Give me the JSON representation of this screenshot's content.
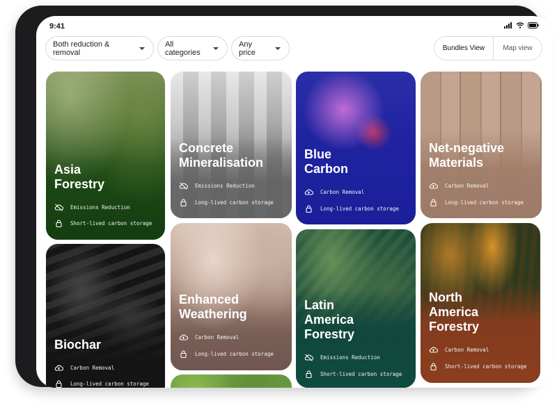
{
  "status": {
    "time": "9:41"
  },
  "filters": [
    {
      "label": "Both reduction & removal"
    },
    {
      "label": "All categories"
    },
    {
      "label": "Any price"
    }
  ],
  "views": {
    "bundles": "Bundles View",
    "map": "Map view"
  },
  "tags": {
    "emissions": "Emissions Reduction",
    "removal": "Carbon Removal",
    "short": "Short-lived carbon storage",
    "long": "Long-lived carbon storage"
  },
  "cards": {
    "asia": {
      "title": "Asia\nForestry"
    },
    "concrete": {
      "title": "Concrete\nMineralisation"
    },
    "blue": {
      "title": "Blue\nCarbon"
    },
    "netneg": {
      "title": "Net-negative\nMaterials"
    },
    "biochar": {
      "title": "Biochar"
    },
    "enhanced": {
      "title": "Enhanced\nWeathering"
    },
    "latin": {
      "title": "Latin\nAmerica\nForestry"
    },
    "north": {
      "title": "North\nAmerica\nForestry"
    }
  },
  "colors": {
    "device": "#1c1c1e",
    "asia": "#143d10",
    "concrete": "#707070",
    "blue": "#1a1f99",
    "netneg": "#9d7a68",
    "biochar": "#1a1a1a",
    "enhanced": "#6f5650",
    "latin": "#0f4a40",
    "north": "#8a3e1e"
  }
}
